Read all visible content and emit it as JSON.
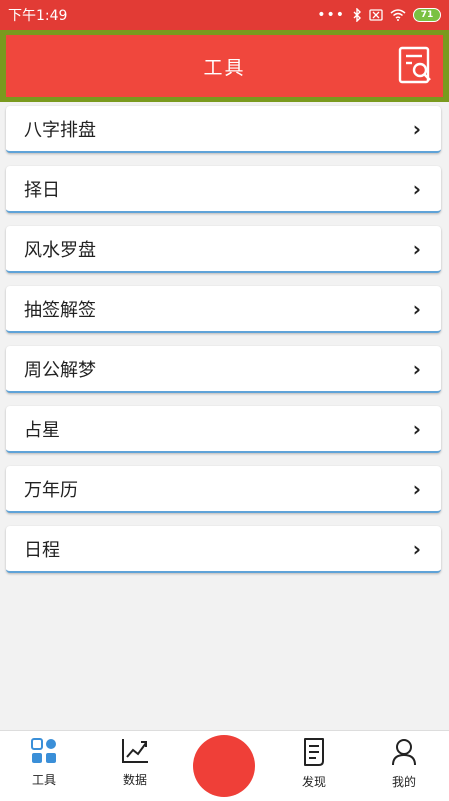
{
  "status_bar": {
    "time": "下午1:49",
    "dots": "•••",
    "battery": "71"
  },
  "header": {
    "title": "工具"
  },
  "tools": [
    {
      "label": "八字排盘"
    },
    {
      "label": "择日"
    },
    {
      "label": "风水罗盘"
    },
    {
      "label": "抽签解签"
    },
    {
      "label": "周公解梦"
    },
    {
      "label": "占星"
    },
    {
      "label": "万年历"
    },
    {
      "label": "日程"
    }
  ],
  "chevron": "›",
  "bottom_nav": {
    "tools": "工具",
    "data": "数据",
    "discover": "发现",
    "mine": "我的"
  },
  "colors": {
    "status_bar": "#e23b35",
    "header": "#f0473d",
    "header_frame": "#7a9a1e",
    "center_button": "#ef3f38",
    "accent_blue": "#5fa3d8"
  }
}
